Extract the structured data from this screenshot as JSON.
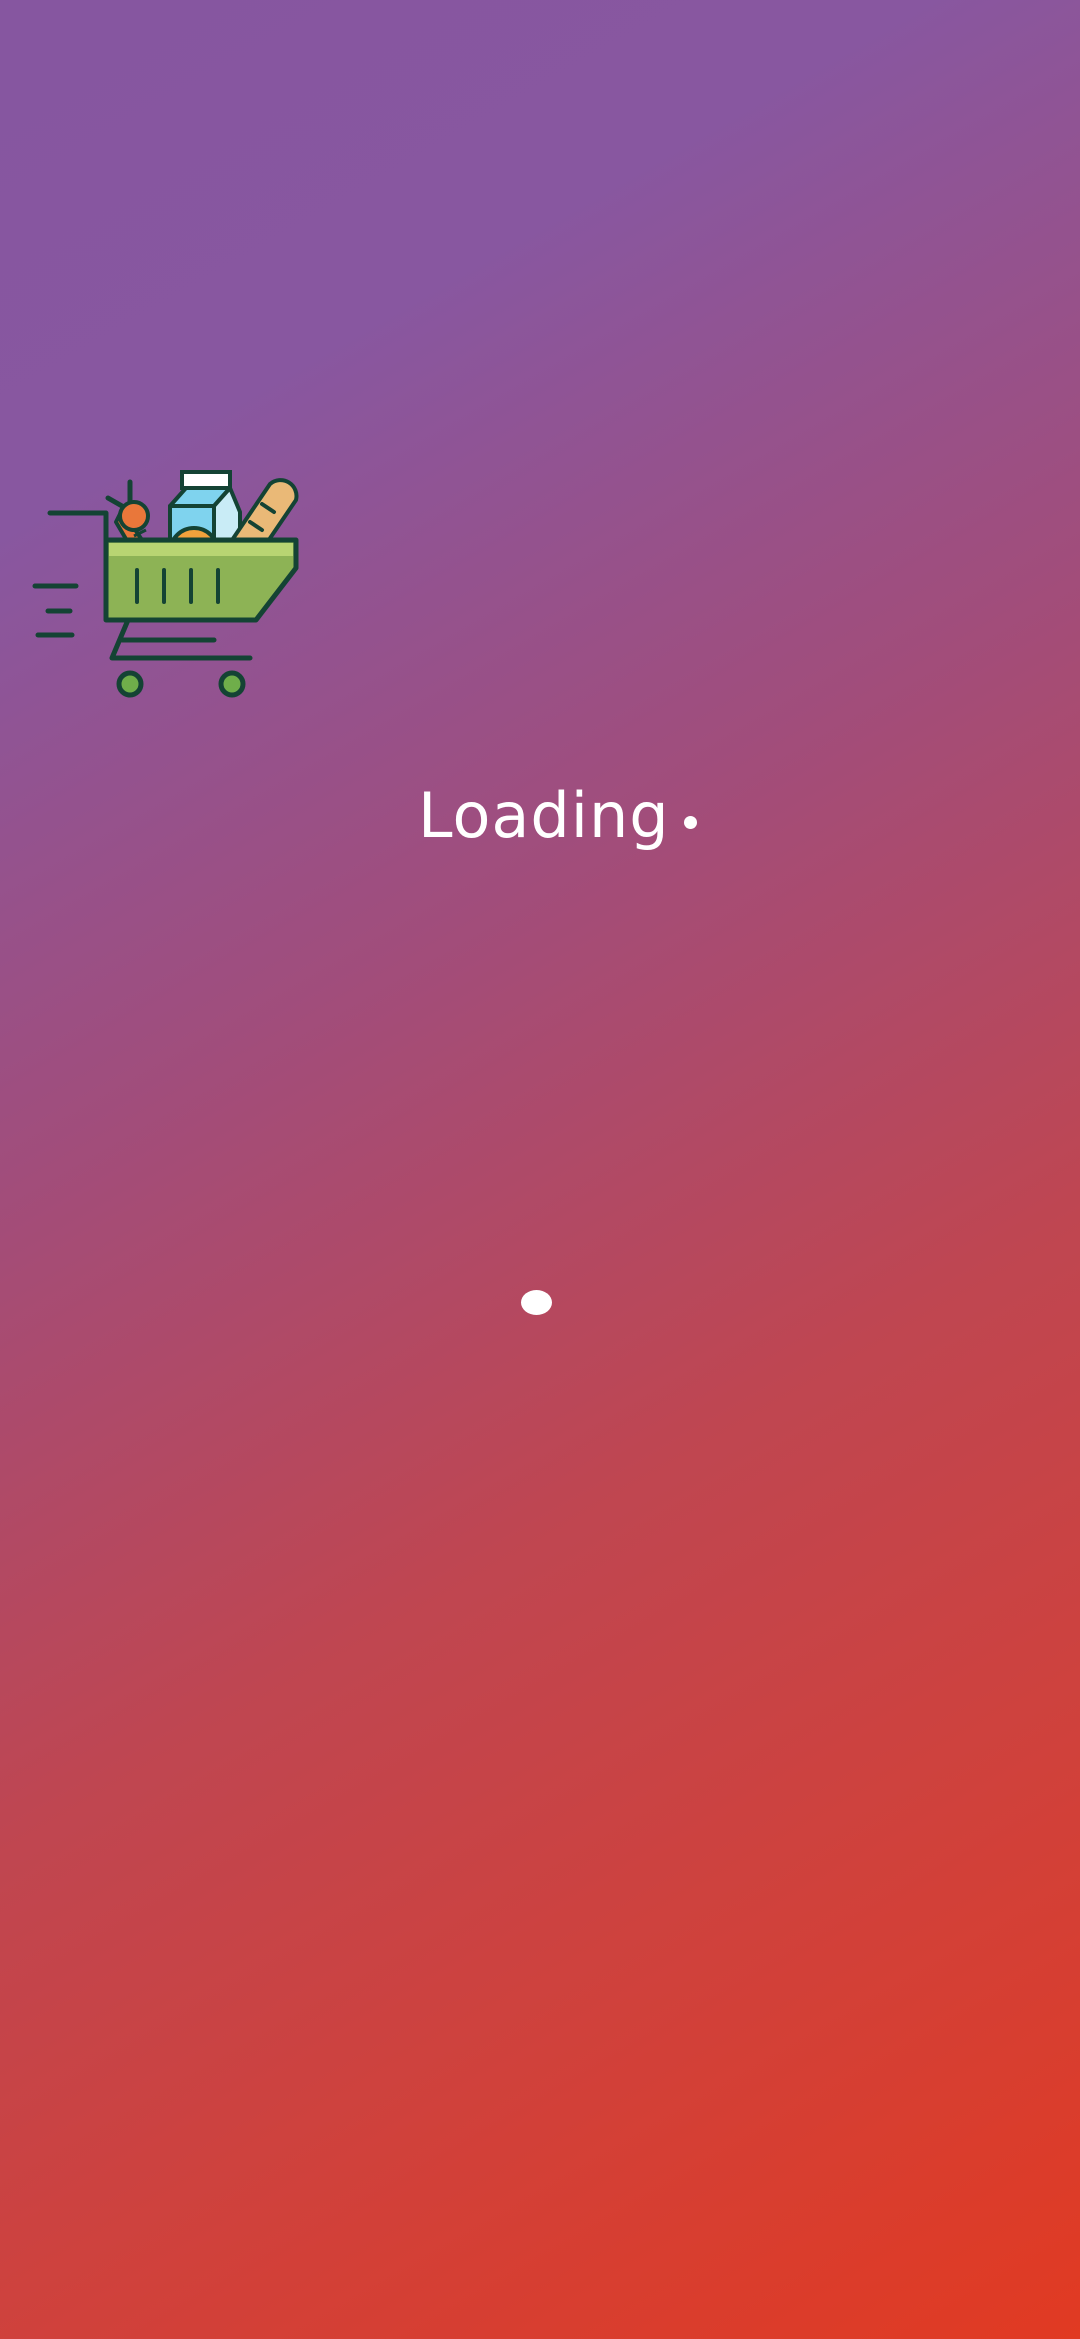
{
  "splash": {
    "logo_icon": "grocery-cart-icon",
    "loading_text": "Loading",
    "loading_indicator_icon": "loading-dot-icon",
    "spinner_icon": "spinner-dot-icon"
  },
  "colors": {
    "gradient_top": "#8656a0",
    "gradient_mid": "#b84a5e",
    "gradient_bottom": "#e13a22",
    "text": "#ffffff",
    "cart_green": "#8db355",
    "cart_outline": "#144334"
  }
}
